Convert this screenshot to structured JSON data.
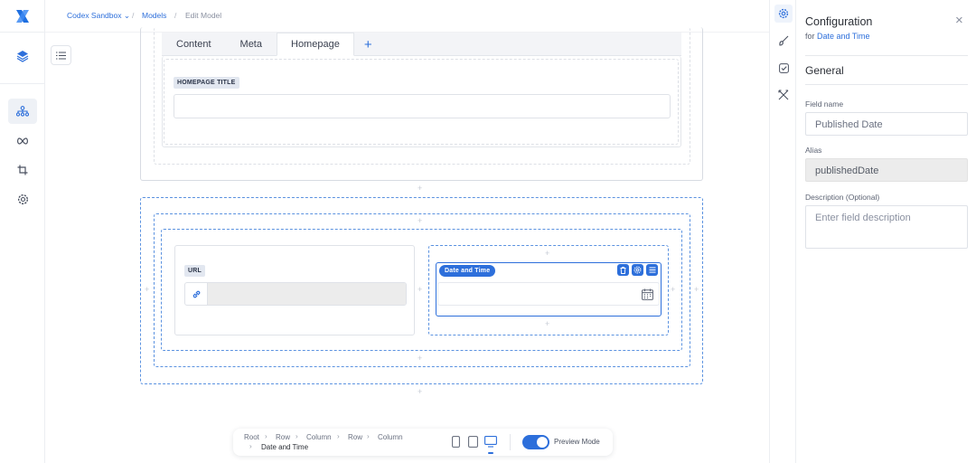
{
  "breadcrumb": {
    "workspace": "Codex Sandbox",
    "workspace_chevron": "⌄",
    "section": "Models",
    "current": "Edit Model",
    "separator": "/"
  },
  "rail": {
    "items": [
      {
        "name": "hierarchy-icon",
        "active": true
      },
      {
        "name": "infinity-icon",
        "active": false
      },
      {
        "name": "crop-icon",
        "active": false
      },
      {
        "name": "settings-icon",
        "active": false
      }
    ]
  },
  "canvas": {
    "tabs": [
      "Content",
      "Meta",
      "Homepage"
    ],
    "active_tab": "Homepage",
    "add_tab_symbol": "+",
    "homepage_title_label": "HOMEPAGE TITLE",
    "url_label": "URL",
    "datetime_label": "Date and Time",
    "plus_symbol": "+"
  },
  "bottom_bar": {
    "path": [
      "Root",
      "Row",
      "Column",
      "Row",
      "Column"
    ],
    "path_last": "Date and Time",
    "path_separator": "›",
    "preview_label": "Preview Mode",
    "preview_on": true,
    "device_selected": "desktop"
  },
  "panel": {
    "title": "Configuration",
    "for_prefix": "for",
    "for_target": "Date and Time",
    "section": "General",
    "field_name_label": "Field name",
    "field_name_value": "Published Date",
    "alias_label": "Alias",
    "alias_value": "publishedDate",
    "description_label": "Description (Optional)",
    "description_placeholder": "Enter field description",
    "close_symbol": "×"
  },
  "colors": {
    "accent": "#2d6fdb",
    "dashed_selected": "#5b92e0"
  }
}
